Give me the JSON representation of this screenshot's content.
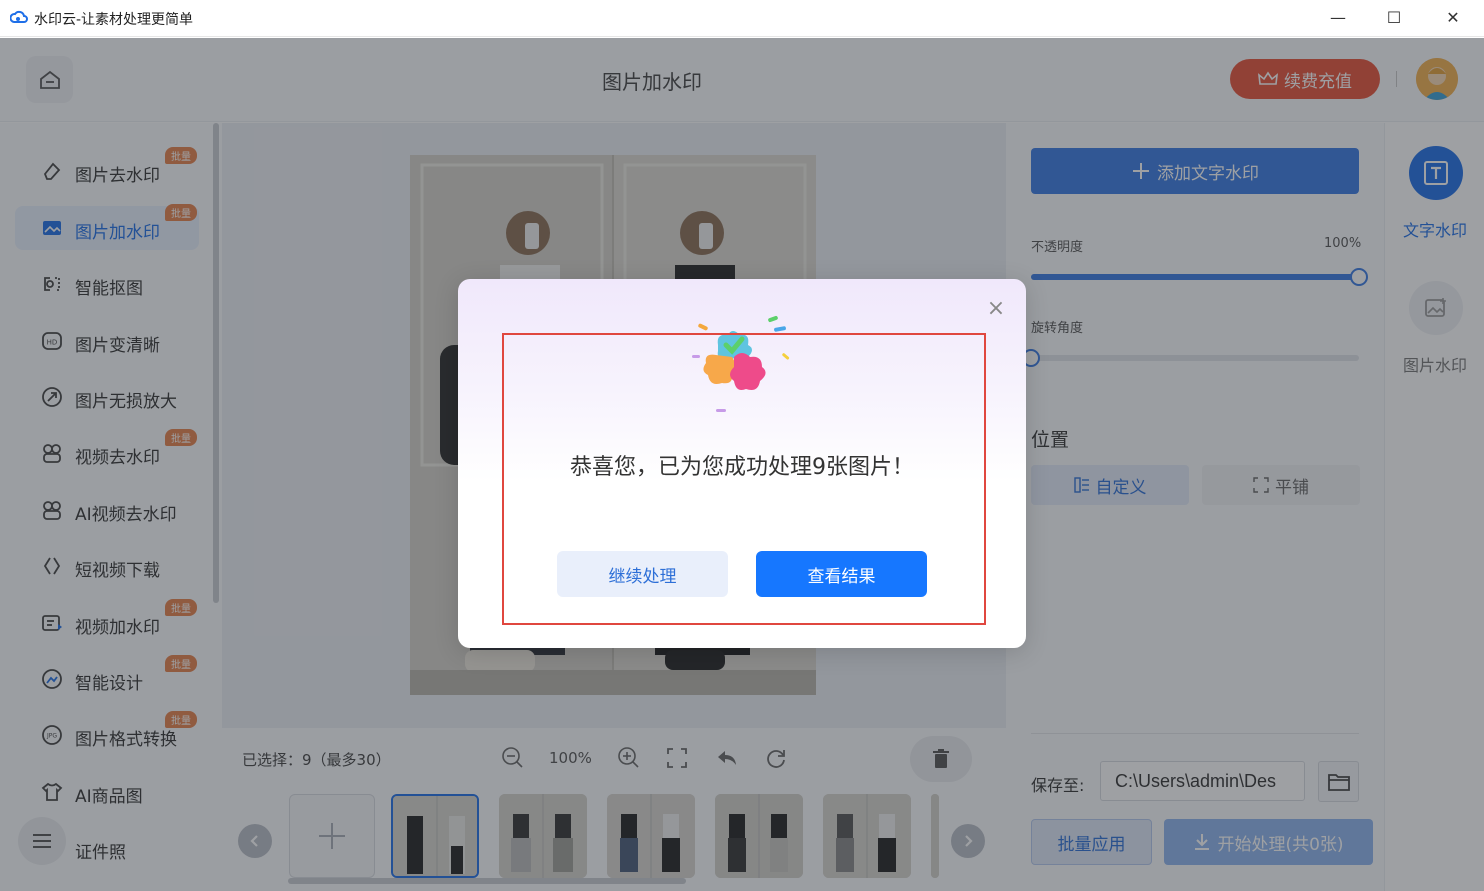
{
  "window": {
    "title": "水印云-让素材处理更简单",
    "minimize_glyph": "—",
    "maximize_glyph": "☐",
    "close_glyph": "✕"
  },
  "header": {
    "page_title": "图片加水印",
    "vip_label": "续费充值"
  },
  "sidebar": {
    "items": [
      {
        "label": "图片去水印",
        "icon": "eraser-icon",
        "badge": "批量"
      },
      {
        "label": "图片加水印",
        "icon": "image-watermark-icon",
        "badge": "批量",
        "active": true
      },
      {
        "label": "智能抠图",
        "icon": "cutout-icon"
      },
      {
        "label": "图片变清晰",
        "icon": "hd-icon"
      },
      {
        "label": "图片无损放大",
        "icon": "enlarge-icon"
      },
      {
        "label": "视频去水印",
        "icon": "video-eraser-icon",
        "badge": "批量"
      },
      {
        "label": "AI视频去水印",
        "icon": "ai-video-icon"
      },
      {
        "label": "短视频下载",
        "icon": "link-icon"
      },
      {
        "label": "视频加水印",
        "icon": "video-watermark-icon",
        "badge": "批量"
      },
      {
        "label": "智能设计",
        "icon": "design-icon",
        "badge": "批量"
      },
      {
        "label": "图片格式转换",
        "icon": "jpg-icon",
        "badge": "批量"
      },
      {
        "label": "AI商品图",
        "icon": "tshirt-icon"
      },
      {
        "label": "证件照",
        "icon": "id-photo-icon"
      }
    ]
  },
  "bottombar": {
    "selected_text": "已选择：9（最多30）",
    "zoom_level": "100%",
    "thumbnail_count": 6
  },
  "right_panel": {
    "add_text_label": "添加文字水印",
    "opacity_label": "不透明度",
    "opacity_value": "100%",
    "opacity_fraction": 1.0,
    "rotation_label": "旋转角度",
    "rotation_fraction": 0.0,
    "position_title": "位置",
    "position_custom": "自定义",
    "position_tile": "平铺",
    "save_label": "保存至:",
    "save_path": "C:\\Users\\admin\\Des",
    "batch_apply": "批量应用",
    "start_process": "开始处理(共0张)"
  },
  "right_tools": {
    "text_watermark": "文字水印",
    "image_watermark": "图片水印"
  },
  "dialog": {
    "message": "恭喜您，已为您成功处理9张图片！",
    "continue_label": "继续处理",
    "view_label": "查看结果"
  },
  "colors": {
    "accent": "#1677ff",
    "vip": "#e8533a",
    "badge": "#e5814b",
    "highlight": "#e0473f"
  }
}
